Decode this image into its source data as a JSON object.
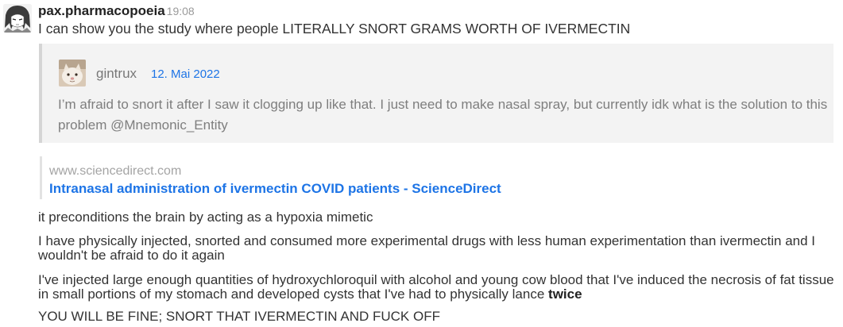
{
  "message": {
    "username": "pax.pharmacopoeia",
    "timestamp": "19:08",
    "text": "I can show you the study where people LITERALLY SNORT GRAMS WORTH OF IVERMECTIN"
  },
  "quote": {
    "username": "gintrux",
    "date": "12. Mai 2022",
    "text": "I’m afraid to snort it after I saw it clogging up like that. I just need to make nasal spray, but currently idk what is the solution to this problem @Mnemonic_Entity"
  },
  "link_preview": {
    "domain": "www.sciencedirect.com",
    "title": "Intranasal administration of ivermectin COVID patients - ScienceDirect"
  },
  "follow_ups": {
    "p1": "it preconditions the brain by acting as a hypoxia mimetic",
    "p2": "I have physically injected, snorted and consumed more experimental drugs with less human experimentation than ivermectin and I wouldn't be afraid to do it again",
    "p3_main": "I've injected large enough quantities of hydroxychloroquil with alcohol and young cow blood that I've induced the necrosis of fat tissue in small portions of my stomach and developed cysts that I've had to physically lance",
    "p3_bold": "twice",
    "p4": "YOU WILL BE FINE; SNORT THAT IVERMECTIN AND FUCK OFF"
  },
  "colors": {
    "link": "#1d74e6",
    "quote_background": "#f3f3f3",
    "quote_border": "#d5d5d5"
  },
  "icons": {
    "user_avatar": "manga-character-avatar",
    "quote_avatar": "cat-avatar"
  }
}
